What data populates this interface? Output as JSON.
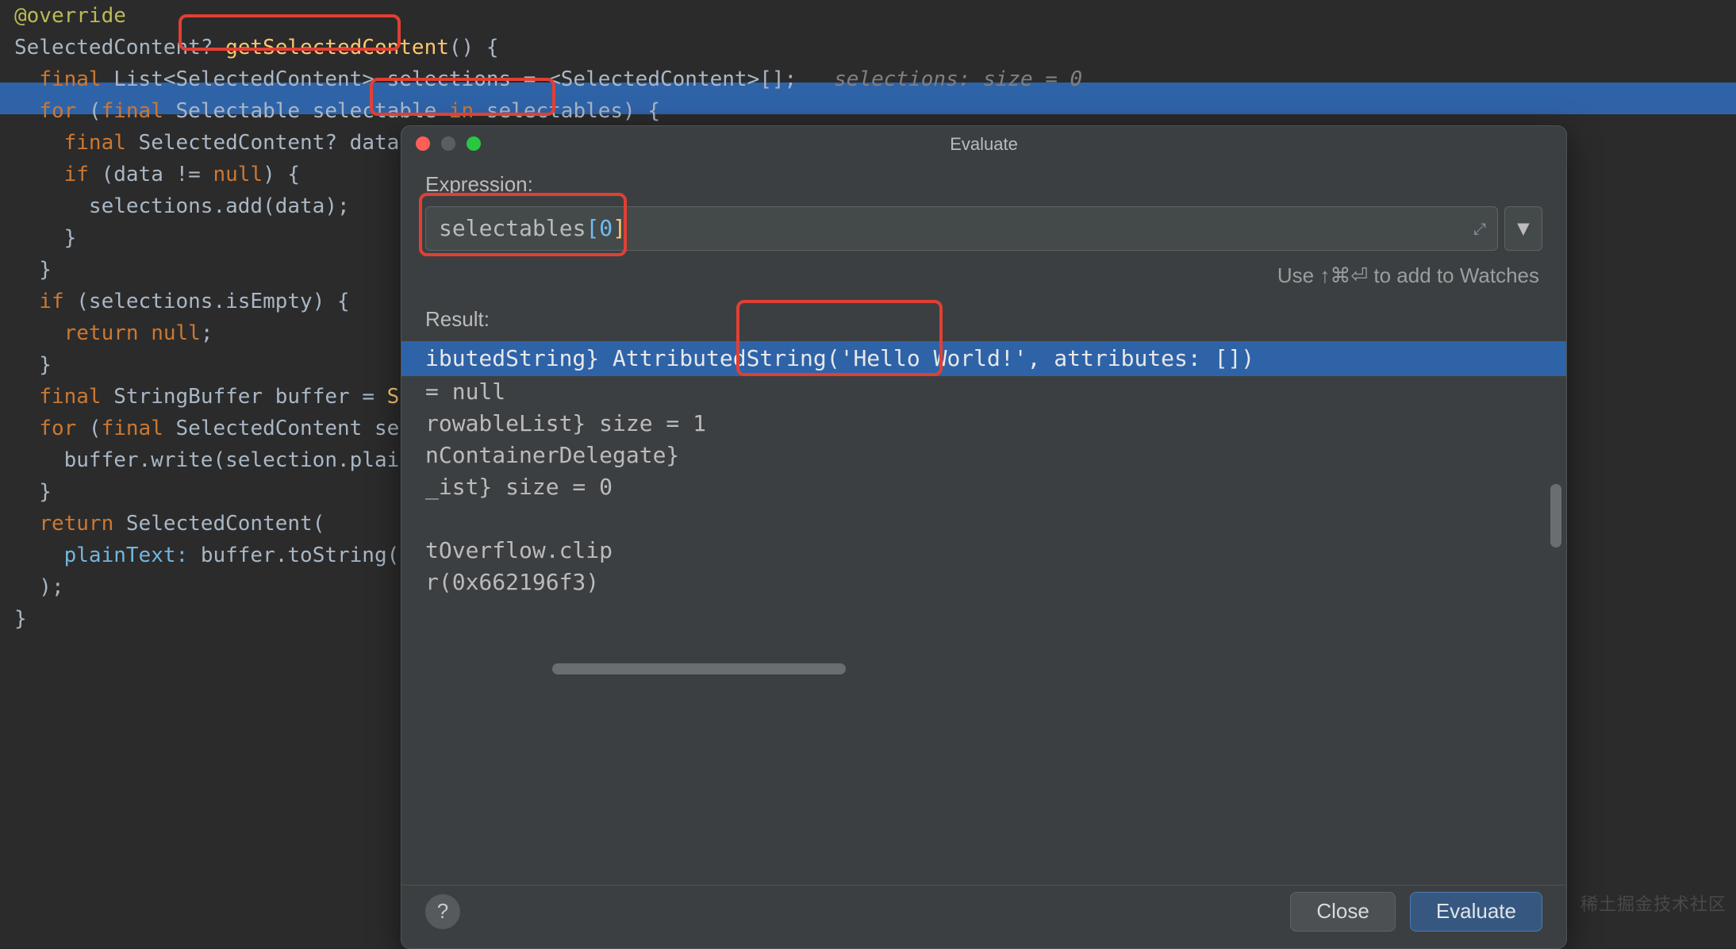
{
  "code": {
    "l0_annotation": "@override",
    "l1_type": "SelectedContent? ",
    "l1_method": "getSelectedContent",
    "l1_tail": "() {",
    "l2_pre": "  ",
    "l2_final": "final",
    "l2_mid": " List<SelectedContent> selections = <SelectedContent>[];   ",
    "l2_hint": "selections: size = 0",
    "l3_pre": "  ",
    "l3_for": "for",
    "l3_sp": " (",
    "l3_final": "final",
    "l3_a": " Selectable selectable ",
    "l3_in": "in",
    "l3_b": " selectables) {",
    "l4_pre": "    ",
    "l4_final": "final",
    "l4_rest": " SelectedContent? data = selectable.getSelectedContent();",
    "l5_pre": "    ",
    "l5_if": "if",
    "l5_rest": " (data != ",
    "l5_null": "null",
    "l5_tail": ") {",
    "l6": "      selections.add(data);",
    "l7": "    }",
    "l8": "  }",
    "l9_pre": "  ",
    "l9_if": "if",
    "l9_rest": " (selections.isEmpty) {",
    "l10_pre": "    ",
    "l10_return": "return ",
    "l10_null": "null",
    "l10_tail": ";",
    "l11": "  }",
    "l12_pre": "  ",
    "l12_final": "final",
    "l12_rest": " StringBuffer buffer = ",
    "l12_call": "StringBu",
    "l13_pre": "  ",
    "l13_for": "for",
    "l13_sp": " (",
    "l13_final": "final",
    "l13_rest": " SelectedContent selection",
    "l14": "    buffer.write(selection.plainText);",
    "l15": "  }",
    "l16_pre": "  ",
    "l16_return": "return",
    "l16_rest": " SelectedContent(",
    "l17_pre": "    ",
    "l17_arg": "plainText: ",
    "l17_rest": "buffer.toString(),",
    "l18": "  );",
    "l19": "}"
  },
  "dialog": {
    "title": "Evaluate",
    "expression_label": "Expression:",
    "expr_ident": "selectables",
    "expr_open": "[",
    "expr_num": "0",
    "expr_close": "]",
    "hint_prefix": "Use ",
    "hint_keys": "↑⌘⏎",
    "hint_suffix": " to add to Watches",
    "result_label": "Result:",
    "results": {
      "r0": "ibutedString} AttributedString('Hello World!', attributes: [])",
      "r1": "= null",
      "r2": "rowableList} size = 1",
      "r3": "nContainerDelegate}",
      "r4": "_ist} size = 0",
      "r6": "tOverflow.clip",
      "r7": "r(0x662196f3)"
    },
    "help": "?",
    "close": "Close",
    "evaluate": "Evaluate",
    "fullscreen_glyph": "⤢",
    "dropdown_glyph": "▼"
  },
  "watermark": "稀土掘金技术社区"
}
